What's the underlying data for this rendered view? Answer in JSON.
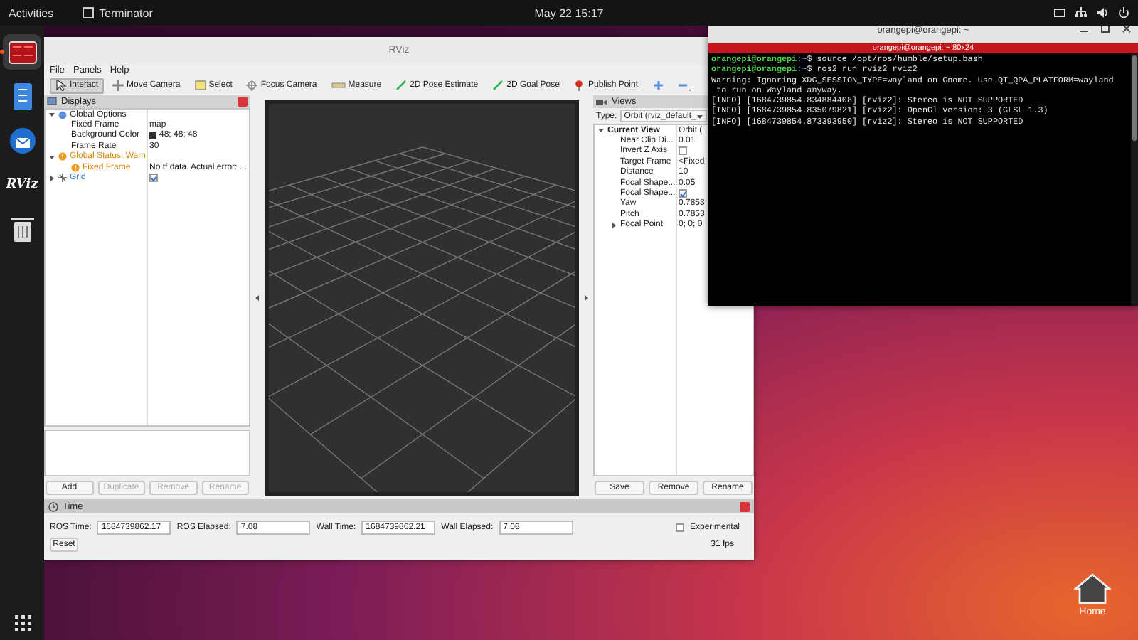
{
  "top_bar": {
    "activities": "Activities",
    "app": "Terminator",
    "clock": "May 22  15:17"
  },
  "dock": [
    {
      "kind": "terminal",
      "active": true
    },
    {
      "kind": "notes",
      "active": false
    },
    {
      "kind": "mail",
      "active": false
    },
    {
      "kind": "logo",
      "text": "RViz",
      "active": false
    },
    {
      "kind": "trash",
      "active": false
    }
  ],
  "desktop_icons": [
    {
      "label": "Home"
    }
  ],
  "rviz": {
    "title": "RViz",
    "menu": [
      "File",
      "Panels",
      "Help"
    ],
    "tools": [
      {
        "kind": "interact",
        "label": "Interact",
        "selected": true
      },
      {
        "kind": "move",
        "label": "Move Camera",
        "selected": false
      },
      {
        "kind": "select",
        "label": "Select",
        "selected": false
      },
      {
        "kind": "focus",
        "label": "Focus Camera",
        "selected": false
      },
      {
        "kind": "measure",
        "label": "Measure",
        "selected": false
      },
      {
        "kind": "pose",
        "label": "2D Pose Estimate",
        "selected": false
      },
      {
        "kind": "goal",
        "label": "2D Goal Pose",
        "selected": false
      },
      {
        "kind": "point",
        "label": "Publish Point",
        "selected": false
      },
      {
        "kind": "add",
        "selected": false
      },
      {
        "kind": "remove",
        "selected": false
      }
    ],
    "displays": {
      "title": "Displays",
      "tree": [
        {
          "label": "Global Options",
          "kind": "option",
          "expanded": true,
          "children": [
            {
              "label": "Fixed Frame",
              "kind": "property",
              "value": {
                "kind": "text",
                "text": "map"
              }
            },
            {
              "label": "Background Color",
              "kind": "property",
              "value": {
                "kind": "color",
                "color": "#303030",
                "text": "48; 48; 48"
              }
            },
            {
              "label": "Frame Rate",
              "kind": "property",
              "value": {
                "kind": "text",
                "text": "30"
              }
            }
          ]
        },
        {
          "label": "Global Status: Warn",
          "kind": "warning",
          "expanded": true,
          "children": [
            {
              "label": "Fixed Frame",
              "kind": "warning",
              "value": {
                "kind": "text",
                "text": "No tf data.  Actual error: ..."
              }
            }
          ]
        },
        {
          "label": "Grid",
          "kind": "display",
          "expanded": false,
          "value": {
            "kind": "checkbox",
            "checked": true
          }
        }
      ],
      "buttons": [
        {
          "label": "Add",
          "disabled": false
        },
        {
          "label": "Duplicate",
          "disabled": true
        },
        {
          "label": "Remove",
          "disabled": true
        },
        {
          "label": "Rename",
          "disabled": true
        }
      ]
    },
    "views": {
      "title": "Views",
      "type_label": "Type:",
      "type_value": "Orbit (rviz_default_",
      "tree": [
        {
          "label": "Current View",
          "kind": "view",
          "expanded": true,
          "value": {
            "kind": "text",
            "text": "Orbit ("
          },
          "children": [
            {
              "label": "Near Clip Di...",
              "kind": "property",
              "value": {
                "kind": "text",
                "text": "0.01"
              }
            },
            {
              "label": "Invert Z Axis",
              "kind": "property",
              "value": {
                "kind": "checkbox",
                "checked": false
              }
            },
            {
              "label": "Target Frame",
              "kind": "property",
              "value": {
                "kind": "text",
                "text": "<Fixed"
              }
            },
            {
              "label": "Distance",
              "kind": "property",
              "value": {
                "kind": "text",
                "text": "10"
              }
            },
            {
              "label": "Focal Shape...",
              "kind": "property",
              "value": {
                "kind": "text",
                "text": "0.05"
              }
            },
            {
              "label": "Focal Shape...",
              "kind": "property",
              "value": {
                "kind": "checkbox",
                "checked": true
              }
            },
            {
              "label": "Yaw",
              "kind": "property",
              "value": {
                "kind": "text",
                "text": "0.7853"
              }
            },
            {
              "label": "Pitch",
              "kind": "property",
              "value": {
                "kind": "text",
                "text": "0.7853"
              }
            },
            {
              "label": "Focal Point",
              "kind": "property",
              "expanded": false,
              "value": {
                "kind": "text",
                "text": "0; 0; 0"
              }
            }
          ]
        }
      ],
      "buttons": [
        {
          "label": "Save",
          "disabled": false
        },
        {
          "label": "Remove",
          "disabled": false
        },
        {
          "label": "Rename",
          "disabled": false
        }
      ]
    },
    "time": {
      "title": "Time",
      "fields": [
        {
          "label": "ROS Time:",
          "value": "1684739862.17"
        },
        {
          "label": "ROS Elapsed:",
          "value": "7.08"
        },
        {
          "label": "Wall Time:",
          "value": "1684739862.21"
        },
        {
          "label": "Wall Elapsed:",
          "value": "7.08"
        }
      ],
      "experimental": {
        "label": "Experimental",
        "checked": false
      },
      "reset": "Reset",
      "fps": "31 fps"
    }
  },
  "terminal": {
    "window_title": "orangepi@orangepi: ~",
    "tab_title": "orangepi@orangepi: ~ 80x24",
    "lines": [
      {
        "kind": "prompt",
        "user": "orangepi@orangepi",
        "path": ":~",
        "command": "$ source /opt/ros/humble/setup.bash"
      },
      {
        "kind": "prompt",
        "user": "orangepi@orangepi",
        "path": ":~",
        "command": "$ ros2 run rviz2 rviz2"
      },
      {
        "kind": "output",
        "text": "Warning: Ignoring XDG_SESSION_TYPE=wayland on Gnome. Use QT_QPA_PLATFORM=wayland"
      },
      {
        "kind": "output",
        "text": " to run on Wayland anyway."
      },
      {
        "kind": "output",
        "text": "[INFO] [1684739854.834884408] [rviz2]: Stereo is NOT SUPPORTED"
      },
      {
        "kind": "output",
        "text": "[INFO] [1684739854.835079821] [rviz2]: OpenGl version: 3 (GLSL 1.3)"
      },
      {
        "kind": "output",
        "text": "[INFO] [1684739854.873393950] [rviz2]: Stereo is NOT SUPPORTED"
      }
    ]
  }
}
